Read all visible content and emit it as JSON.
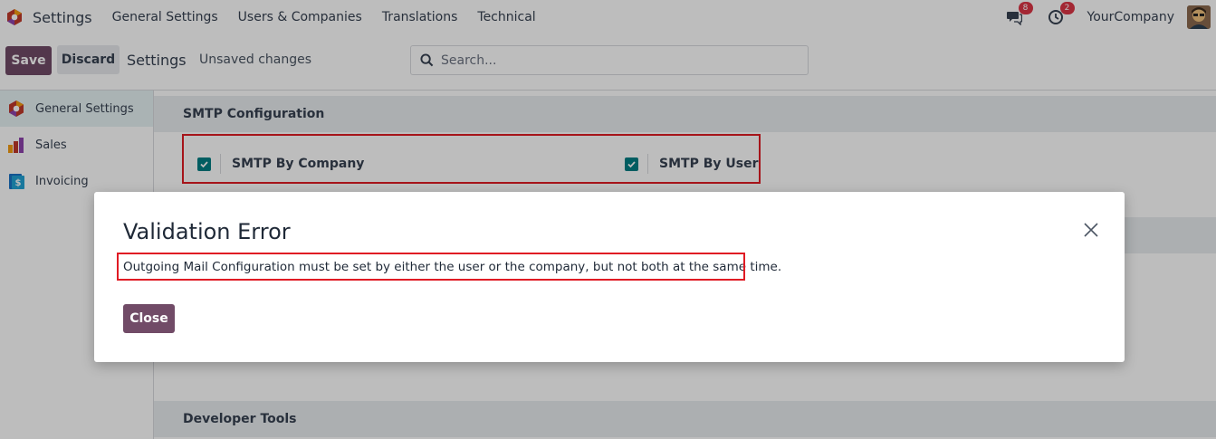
{
  "navbar": {
    "app_name": "Settings",
    "menus": [
      "General Settings",
      "Users & Companies",
      "Translations",
      "Technical"
    ],
    "messages_badge": "8",
    "activities_badge": "2",
    "company": "YourCompany"
  },
  "control_panel": {
    "save_label": "Save",
    "discard_label": "Discard",
    "title": "Settings",
    "unsaved": "Unsaved changes",
    "search_placeholder": "Search..."
  },
  "sidebar": {
    "items": [
      {
        "label": "General Settings",
        "icon": "settings-app-icon",
        "active": true
      },
      {
        "label": "Sales",
        "icon": "sales-app-icon",
        "active": false
      },
      {
        "label": "Invoicing",
        "icon": "invoicing-app-icon",
        "active": false
      }
    ]
  },
  "sections": {
    "smtp": {
      "title": "SMTP Configuration",
      "by_company_label": "SMTP By Company",
      "by_company_checked": true,
      "by_user_label": "SMTP By User",
      "by_user_checked": true
    },
    "developer": {
      "title": "Developer Tools"
    }
  },
  "dialog": {
    "title": "Validation Error",
    "message": "Outgoing Mail Configuration must be set by either the user or the company, but not both at the same time.",
    "close_label": "Close"
  },
  "colors": {
    "primary": "#714b67",
    "checkbox": "#017e84",
    "badge": "#dc3545",
    "highlight": "#e01b24"
  }
}
